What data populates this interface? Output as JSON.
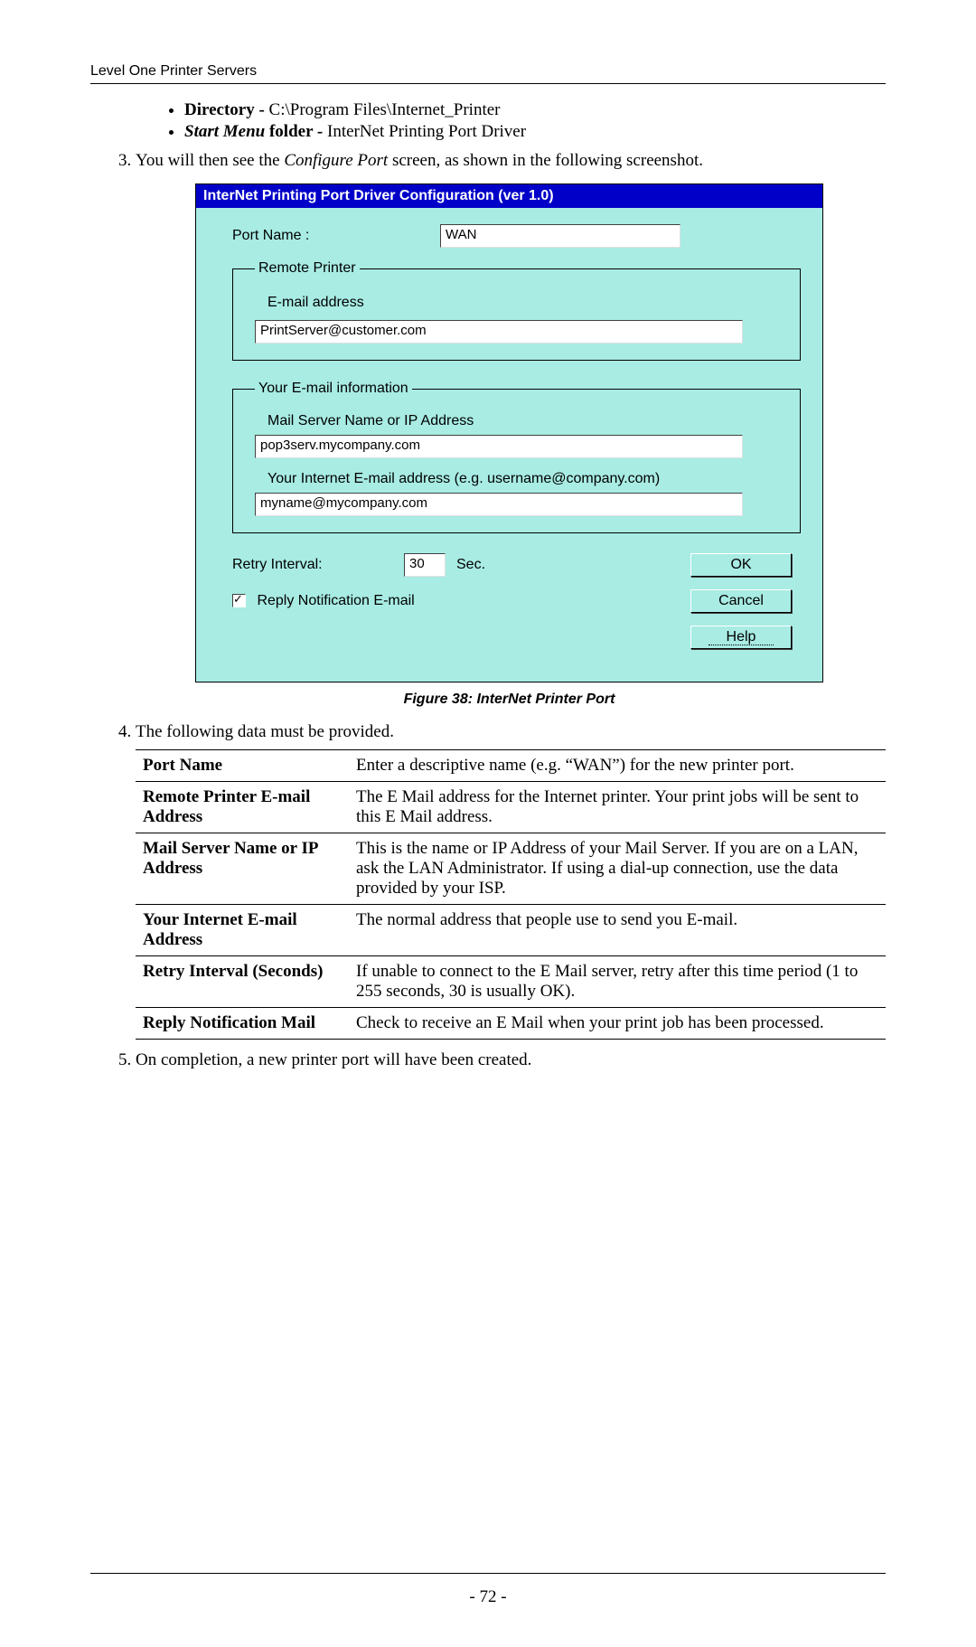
{
  "header": "Level One Printer Servers",
  "page_number": "- 72 -",
  "bullets": {
    "dir_label": "Directory - ",
    "dir_value": "C:\\Program Files\\Internet_Printer",
    "start_label_em": "Start Menu",
    "start_label_rest": " folder - ",
    "start_value": "InterNet Printing Port Driver"
  },
  "steps": {
    "s3_a": "You will then see the ",
    "s3_em": "Configure Port",
    "s3_b": " screen, as shown in the following screenshot.",
    "s4": "The following data must be provided.",
    "s5": "On completion, a new printer port will have been created."
  },
  "dialog": {
    "title": "InterNet Printing Port Driver Configuration  (ver 1.0)",
    "port_label": "Port Name :",
    "port_value": "WAN",
    "group_remote": "Remote Printer",
    "remote_email_label": "E-mail address",
    "remote_email_value": "PrintServer@customer.com",
    "group_your": "Your E-mail information",
    "mailserver_label": "Mail Server Name or IP Address",
    "mailserver_value": "pop3serv.mycompany.com",
    "yourmail_label": "Your Internet E-mail address (e.g. username@company.com)",
    "yourmail_value": "myname@mycompany.com",
    "retry_label": "Retry Interval:",
    "retry_value": "30",
    "retry_unit": "Sec.",
    "reply_label": "Reply Notification E-mail",
    "btn_ok": "OK",
    "btn_cancel": "Cancel",
    "btn_help": "Help"
  },
  "caption": "Figure 38: InterNet Printer Port",
  "table": {
    "r1k": "Port Name",
    "r1v": "Enter a descriptive name (e.g. “WAN”) for the new printer port.",
    "r2k": "Remote Printer E-mail Address",
    "r2v": "The E Mail address for the Internet printer. Your print jobs will be sent to this E Mail address.",
    "r3k": "Mail Server Name or IP Address",
    "r3v": "This is the name or IP Address of your Mail Server. If you are on a LAN, ask the LAN Administrator. If using a dial-up connection, use the data provided by your ISP.",
    "r4k": "Your Internet E-mail Address",
    "r4v": "The normal address that people use to send you E-mail.",
    "r5k": "Retry Interval (Seconds)",
    "r5v": "If unable to connect to the E Mail server, retry after this time period (1 to 255 seconds, 30 is usually OK).",
    "r6k": "Reply Notification Mail",
    "r6v": "Check to receive an E Mail when your print job has been processed."
  }
}
